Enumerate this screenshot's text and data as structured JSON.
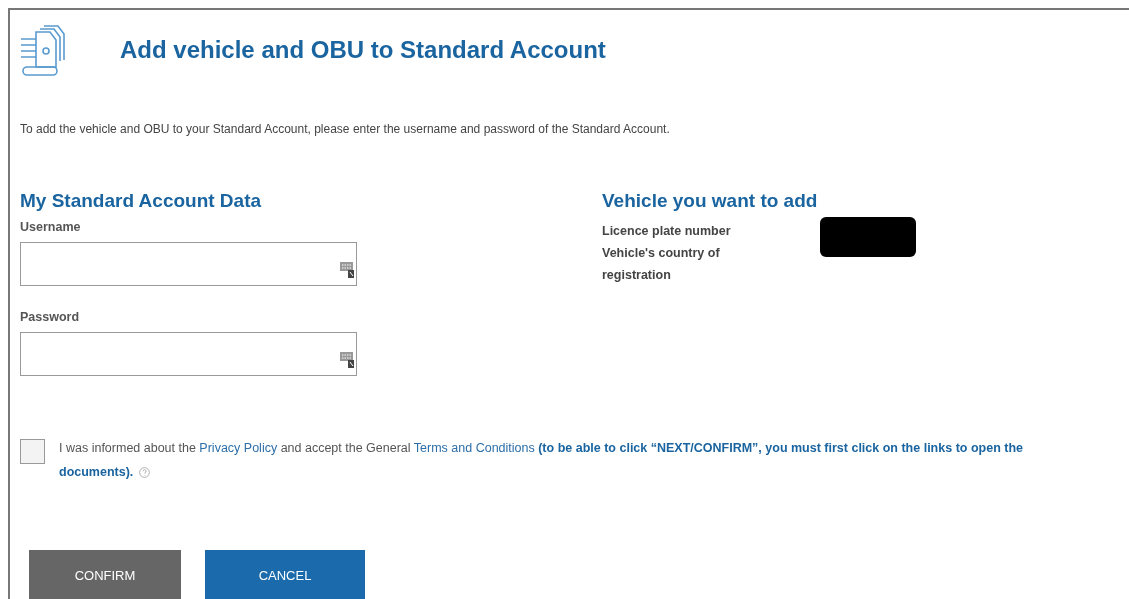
{
  "header": {
    "title": "Add vehicle and OBU to Standard Account"
  },
  "intro": "To add the vehicle and OBU to your Standard Account, please enter the username and password of the Standard Account.",
  "account": {
    "heading": "My Standard Account Data",
    "fields": [
      {
        "label": "Username"
      },
      {
        "label": "Password"
      }
    ]
  },
  "vehicle": {
    "heading": "Vehicle you want to add",
    "rows": [
      {
        "label": "Licence plate number",
        "redacted": true
      },
      {
        "label": "Vehicle's country of registration",
        "redacted": false
      }
    ]
  },
  "consent": {
    "checked": false,
    "parts": [
      {
        "kind": "text",
        "text": "I was informed about the "
      },
      {
        "kind": "link",
        "text": "Privacy Policy"
      },
      {
        "kind": "text",
        "text": " and accept the General "
      },
      {
        "kind": "link",
        "text": "Terms and Conditions"
      },
      {
        "kind": "bold",
        "text": " (to be able to click “NEXT/CONFIRM”, you must first click on the links to open the documents)."
      }
    ]
  },
  "buttons": [
    {
      "label": "CONFIRM",
      "kind": "secondary"
    },
    {
      "label": "CANCEL",
      "kind": "primary"
    }
  ]
}
